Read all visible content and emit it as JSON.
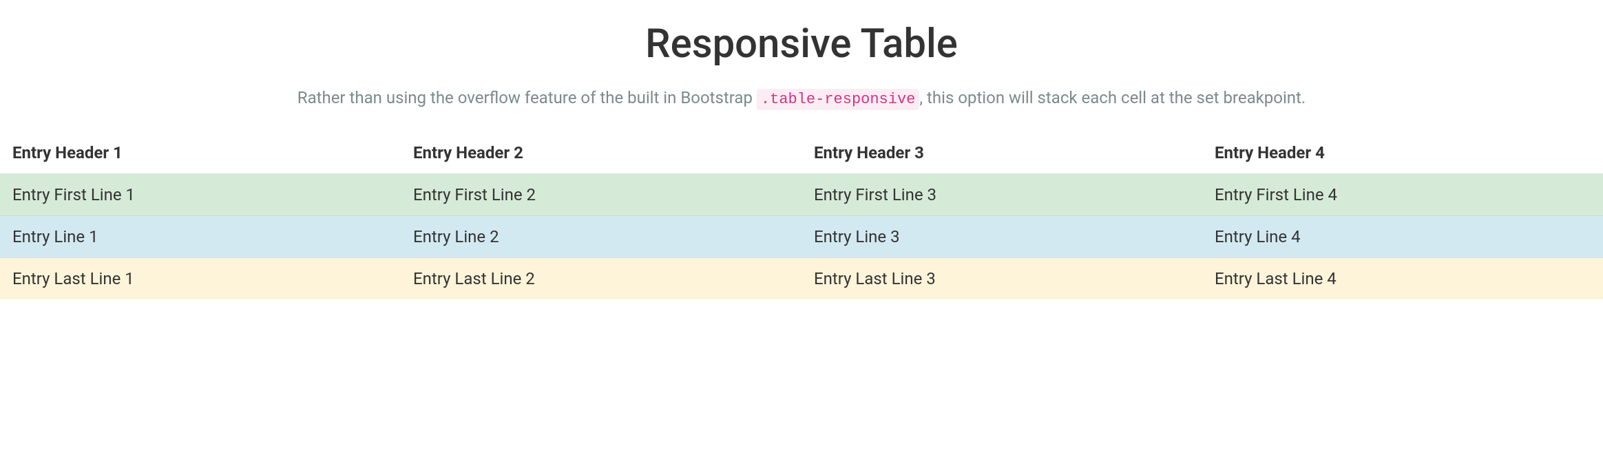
{
  "title": "Responsive Table",
  "description": {
    "before": "Rather than using the overflow feature of the built in Bootstrap ",
    "code": ".table-responsive",
    "after": ", this option will stack each cell at the set breakpoint."
  },
  "table": {
    "headers": [
      "Entry Header 1",
      "Entry Header 2",
      "Entry Header 3",
      "Entry Header 4"
    ],
    "rows": [
      {
        "variant": "success",
        "cells": [
          "Entry First Line 1",
          "Entry First Line 2",
          "Entry First Line 3",
          "Entry First Line 4"
        ]
      },
      {
        "variant": "info",
        "cells": [
          "Entry Line 1",
          "Entry Line 2",
          "Entry Line 3",
          "Entry Line 4"
        ]
      },
      {
        "variant": "warning",
        "cells": [
          "Entry Last Line 1",
          "Entry Last Line 2",
          "Entry Last Line 3",
          "Entry Last Line 4"
        ]
      }
    ]
  }
}
